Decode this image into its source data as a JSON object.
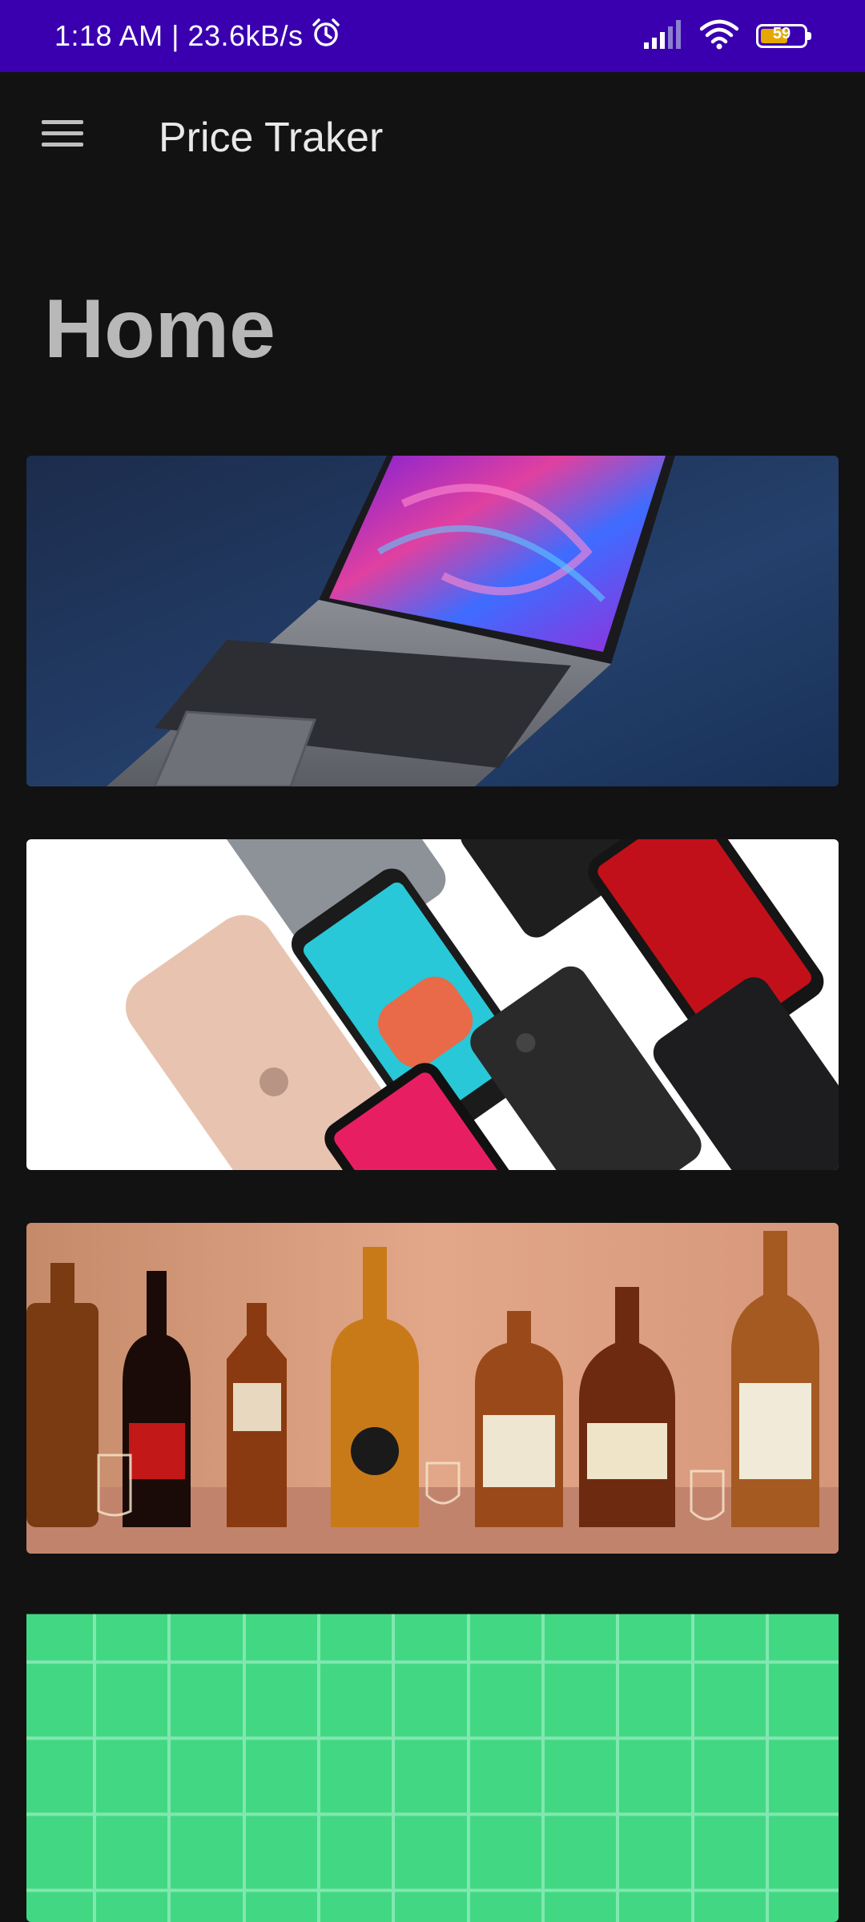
{
  "status_bar": {
    "time_speed": "1:18 AM | 23.6kB/s",
    "battery_level": "59",
    "icons": [
      "alarm-icon",
      "signal-icon",
      "wifi-icon",
      "battery-icon"
    ]
  },
  "app_bar": {
    "title": "Price Traker",
    "menu_icon": "hamburger-menu-icon"
  },
  "page": {
    "title": "Home"
  },
  "categories": [
    {
      "image": "laptop-image"
    },
    {
      "image": "smartphones-image"
    },
    {
      "image": "liquor-bottles-image"
    },
    {
      "image": "green-grid-image"
    }
  ],
  "colors": {
    "status_bar": "#3a00b0",
    "background": "#121212",
    "accent_green": "#42d883"
  }
}
